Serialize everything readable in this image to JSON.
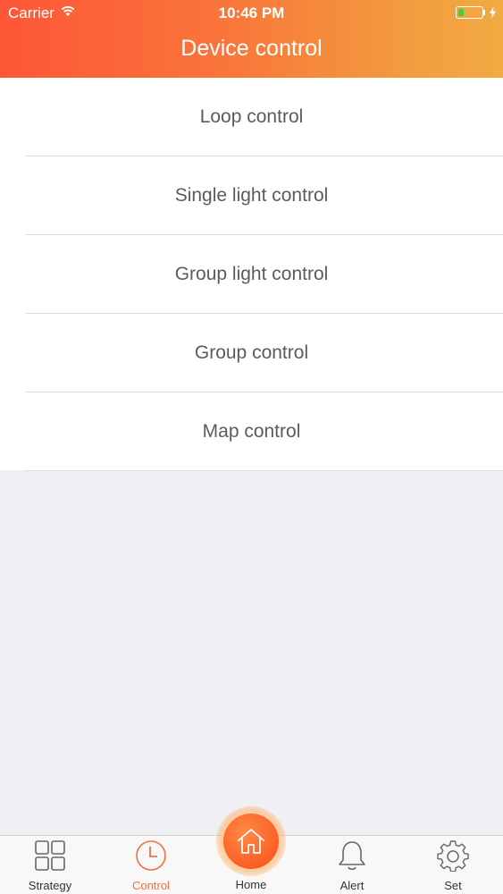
{
  "status_bar": {
    "carrier": "Carrier",
    "time": "10:46 PM",
    "battery_level": 0.25,
    "battery_color": "#3ecf3e"
  },
  "header": {
    "title": "Device control",
    "gradient_start": "#fd5637",
    "gradient_end": "#f2ab43"
  },
  "menu": {
    "items": [
      {
        "label": "Loop control"
      },
      {
        "label": "Single light control"
      },
      {
        "label": "Group light control"
      },
      {
        "label": "Group control"
      },
      {
        "label": "Map control"
      }
    ]
  },
  "tabbar": {
    "active_color": "#f4703a",
    "tabs": [
      {
        "label": "Strategy",
        "icon": "grid-icon",
        "active": false
      },
      {
        "label": "Control",
        "icon": "clock-icon",
        "active": true
      },
      {
        "label": "Home",
        "icon": "home-icon",
        "active": false
      },
      {
        "label": "Alert",
        "icon": "bell-icon",
        "active": false
      },
      {
        "label": "Set",
        "icon": "gear-icon",
        "active": false
      }
    ]
  }
}
